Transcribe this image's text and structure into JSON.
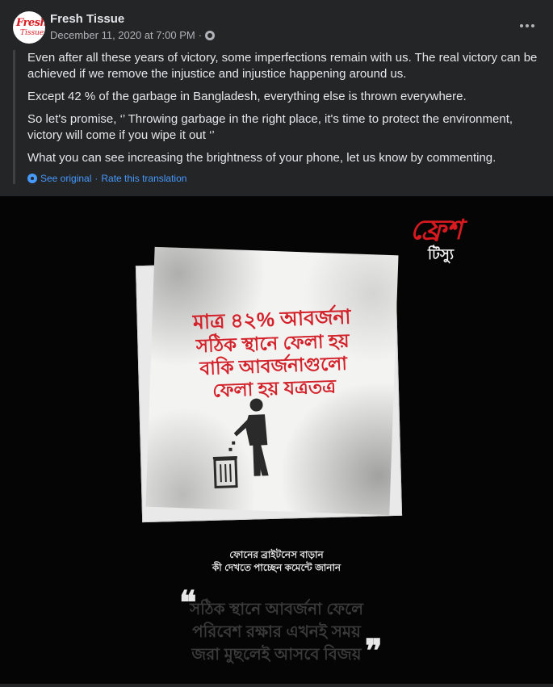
{
  "post": {
    "page_name": "Fresh Tissue",
    "timestamp": "December 11, 2020 at 7:00 PM",
    "separator": "·",
    "avatar_brand_line1": "Fresh",
    "avatar_brand_line2": "Tissue",
    "paragraphs": [
      "Even after all these years of victory, some imperfections remain with us. The real victory can be achieved if we remove the injustice and injustice happening around us.",
      "Except 42 % of the garbage in Bangladesh, everything else is thrown everywhere.",
      "So let's promise, ‘’ Throwing garbage in the right place, it's time to protect the environment, victory will come if you wipe it out ‘’",
      "What you can see increasing the brightness of your phone, let us know by commenting."
    ],
    "translation": {
      "see_original": "See original",
      "dot": "·",
      "rate": "Rate this translation"
    }
  },
  "image": {
    "logo_main": "ফ্রেশ",
    "logo_sub": "টিস্যু",
    "napkin_lines": [
      "মাত্র ৪২% আবর্জনা",
      "সঠিক স্থানে ফেলা হয়",
      "বাকি আবর্জনাগুলো",
      "ফেলা হয় যত্রতত্র"
    ],
    "caption_lines": [
      "ফোনের ব্রাইটনেস বাড়ান",
      "কী দেখতে পাচ্ছেন কমেন্টে জানান"
    ],
    "quote_lines": [
      "সঠিক স্থানে আবর্জনা ফেলে",
      "পরিবেশ রক্ষার এখনই সময়",
      "জরা মুছলেই আসবে বিজয়"
    ],
    "quote_open": "❝",
    "quote_close": "❞"
  },
  "colors": {
    "card_bg": "#242526",
    "link": "#4599ff",
    "brand_red": "#d71920",
    "napkin_text": "#d4222b"
  },
  "icons": [
    "globe-icon",
    "more-options-icon",
    "translate-gear-icon"
  ]
}
